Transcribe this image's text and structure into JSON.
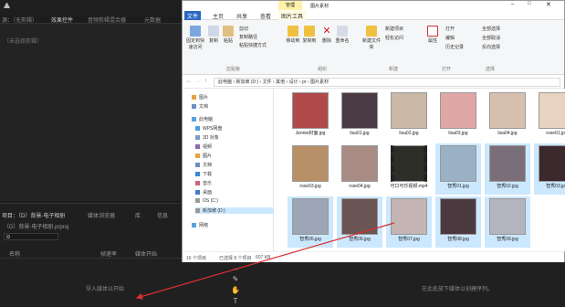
{
  "editor": {
    "tabs": [
      "源：（无剪辑）",
      "效果控件",
      "音频剪辑混合器",
      "元数据"
    ],
    "no_clip": "（未选择剪辑）",
    "project_tabs": [
      "项目：（D）背景-电子相册",
      "媒体浏览器",
      "库",
      "信息"
    ],
    "project_file": "（D）背景-电子相册.prproj",
    "columns": [
      "名称",
      "帧速率",
      "媒体开始"
    ],
    "import_hint": "导入媒体以开始",
    "drop_hint": "在此处放下媒体以创建序列。",
    "tool_icons": [
      "ripple-edit-icon",
      "razor-icon",
      "hand-icon",
      "type-icon"
    ]
  },
  "explorer": {
    "title": "图片素材",
    "manage_tab": "管理",
    "ribbon_tabs": [
      "文件",
      "主页",
      "共享",
      "查看",
      "图片工具"
    ],
    "ribbon": {
      "pin": "固定到快速访问",
      "copy": "复制",
      "paste": "粘贴",
      "cut": "剪切",
      "copy_path": "复制路径",
      "paste_shortcut": "粘贴快捷方式",
      "move_to": "移动到",
      "copy_to": "复制到",
      "delete": "删除",
      "rename": "重命名",
      "new_folder": "新建文件夹",
      "new_item": "新建项目",
      "easy_access": "轻松访问",
      "properties": "属性",
      "open": "打开",
      "edit": "编辑",
      "history": "历史记录",
      "select_all": "全部选择",
      "select_none": "全部取消",
      "invert": "反向选择",
      "groups": [
        "剪贴板",
        "组织",
        "新建",
        "打开",
        "选择"
      ]
    },
    "breadcrumb": [
      "此电脑",
      "新加坡 (D:)",
      "文件",
      "其他",
      "设计",
      "pr",
      "图片素材"
    ],
    "nav": [
      "图片",
      "文档",
      "此电脑",
      "WPS网盘",
      "3D 对象",
      "视频",
      "图片",
      "文档",
      "下载",
      "音乐",
      "桌面",
      "OS (C:)",
      "新加坡 (D:)",
      "网络"
    ],
    "files": [
      {
        "name": "Jennie封面.jpg",
        "color": "#b04a4a",
        "sel": false
      },
      {
        "name": "lisa01.jpg",
        "color": "#4a3a44",
        "sel": false
      },
      {
        "name": "lisa02.jpg",
        "color": "#c9b9a6",
        "sel": false
      },
      {
        "name": "lisa03.jpg",
        "color": "#e0a7a7",
        "sel": false
      },
      {
        "name": "lisa04.jpg",
        "color": "#d8c0b0",
        "sel": false
      },
      {
        "name": "rose01.jpg",
        "color": "#e8d2c0",
        "sel": false
      },
      {
        "name": "rose03.jpg",
        "color": "#b89068",
        "sel": false
      },
      {
        "name": "rose04.jpg",
        "color": "#a88c84",
        "sel": false
      },
      {
        "name": "可口可乐视频.mp4",
        "color": "#2e2e28",
        "sel": false
      },
      {
        "name": "智秀01.jpg",
        "color": "#9ab0c4",
        "sel": true
      },
      {
        "name": "智秀02.jpg",
        "color": "#7a6e78",
        "sel": true
      },
      {
        "name": "智秀03.jpg",
        "color": "#3a2a2e",
        "sel": true
      },
      {
        "name": "智秀05.jpg",
        "color": "#9ca6b6",
        "sel": true
      },
      {
        "name": "智秀06.jpg",
        "color": "#6a5454",
        "sel": true
      },
      {
        "name": "智秀07.jpg",
        "color": "#c4b4b4",
        "sel": true
      },
      {
        "name": "智秀08.jpg",
        "color": "#4a3a40",
        "sel": true
      },
      {
        "name": "智秀09.jpg",
        "color": "#b4b4c0",
        "sel": true
      }
    ],
    "status": "16 个项目",
    "status_sel": "已选择 8 个项目",
    "status_size": "607 KB"
  }
}
